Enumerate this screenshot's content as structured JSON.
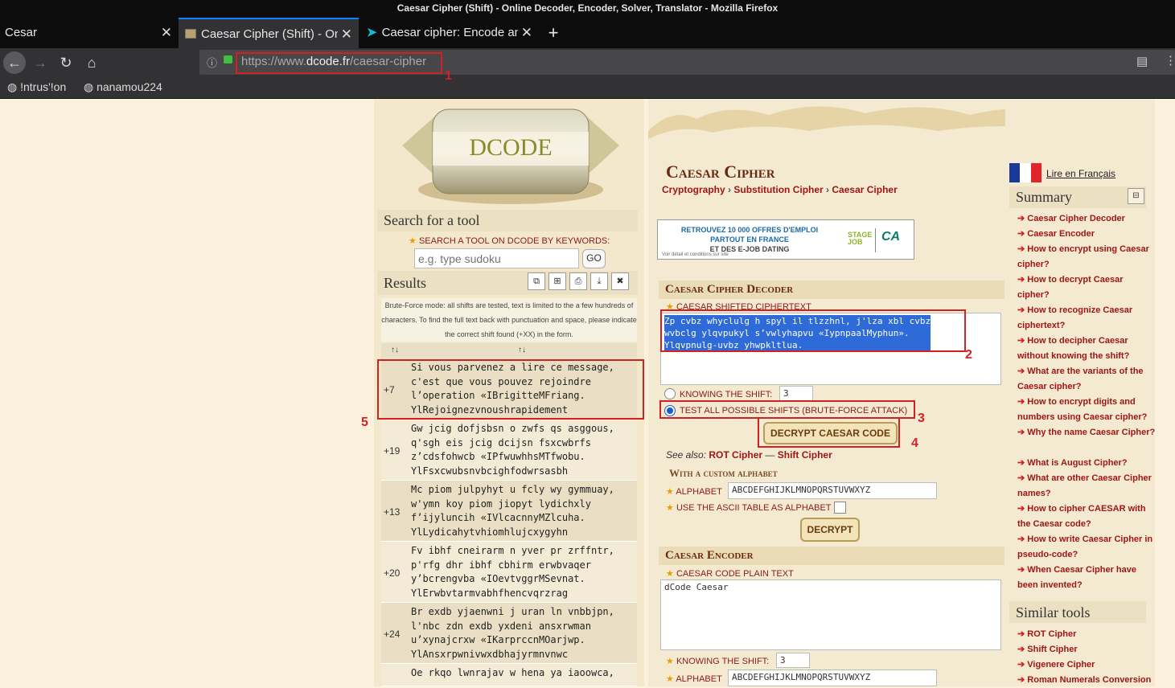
{
  "window": {
    "title": "Caesar Cipher (Shift) - Online Decoder, Encoder, Solver, Translator - Mozilla Firefox"
  },
  "tabs": [
    {
      "label": "Cesar"
    },
    {
      "label": "Caesar Cipher (Shift) - On"
    },
    {
      "label": "Caesar cipher: Encode an"
    }
  ],
  "url": {
    "prefix": "https://www.",
    "domain": "dcode.fr",
    "path": "/caesar-cipher"
  },
  "bookmarks": [
    {
      "label": "!ntrus'!on"
    },
    {
      "label": "nanamou224"
    }
  ],
  "annotations": [
    "1",
    "2",
    "3",
    "4",
    "5"
  ],
  "left": {
    "logo_text": "DCODE",
    "search_title": "Search for a tool",
    "search_label": "SEARCH A TOOL ON DCODE BY KEYWORDS:",
    "search_placeholder": "e.g. type sudoku",
    "go": "GO",
    "results_title": "Results",
    "brute_note": "Brute-Force mode: all shifts are tested, text is limited to the a few hundreds of characters. To find the full text back with punctuation and space, please indicate the correct shift found (+XX) in the form.",
    "sort1": "↑↓",
    "sort2": "↑↓",
    "rows": [
      {
        "shift": "+7",
        "text": "Si vous parvenez a lire ce message,\nc'est que vous pouvez rejoindre\nl’operation «IBrigitteMFriang.\nYlRejoignezvnoushrapidement"
      },
      {
        "shift": "+19",
        "text": "Gw jcig dofjsbsn o zwfs qs asggous,\nq'sgh eis jcig dcijsn fsxcwbrfs\nz’cdsfohwcb «IPfwuwhhsMTfwobu.\nYlFsxcwubsnvbcighfodwrsasbh"
      },
      {
        "shift": "+13",
        "text": "Mc piom julpyhyt u fcly wy gymmuay,\nw'ymn koy piom jiopyt lydichxly\nf’ijyluncih «IVlcacnnyMZlcuha.\nYlLydicahytvhiomhlujcxygyhn"
      },
      {
        "shift": "+20",
        "text": "Fv ibhf cneirarm n yver pr zrffntr,\np'rfg dhr ibhf cbhirm erwbvaqer\ny’bcrengvba «IOevtvggrMSevnat.\nYlErwbvtarmvabhfhencvqrzrag"
      },
      {
        "shift": "+24",
        "text": "Br exdb yjaenwni j uran ln vnbbjpn,\nl'nbc zdn exdb yxdeni ansxrwman\nu’xynajcrxw «IKarprccnMOarjwp.\nYlAnsxrpwnivwxdbhajyrmnvnwc"
      },
      {
        "shift": "",
        "text": "Oe rkqo lwnrajav w hena ya iaoowca,"
      }
    ]
  },
  "main": {
    "title": "Caesar Cipher",
    "breadcrumb": [
      "Cryptography",
      "Substitution Cipher",
      "Caesar Cipher"
    ],
    "ad": {
      "line1": "RETROUVEZ 10 000 OFFRES D'EMPLOI",
      "line2": "PARTOUT EN FRANCE",
      "line3": "ET DES E-JOB DATING",
      "small": "Voir détail et conditions sur site",
      "brand": "STAGE JOB",
      "brand2": "CA"
    },
    "decoder": {
      "title": "Caesar Cipher Decoder",
      "cipher_label": "CAESAR SHIFTED CIPHERTEXT",
      "ciphertext": "Zp cvbz whyclulg h spyl il tlzzhnl, j'lza xbl cvbz\nwvbclg ylqvpukyl s’vwlyhapvu «IypnpaalMyphun».\nYlqvpnulg-uvbz yhwpkltlua.",
      "knowing_label": "KNOWING THE SHIFT:",
      "shift_value": "3",
      "bruteforce_label": "TEST ALL POSSIBLE SHIFTS (BRUTE-FORCE ATTACK)",
      "decrypt_button": "DECRYPT CAESAR CODE",
      "see_also": "See also:",
      "see_also_1": "ROT Cipher",
      "see_also_sep": "—",
      "see_also_2": "Shift Cipher",
      "custom_alpha_title": "With a custom alphabet",
      "alphabet_label": "ALPHABET",
      "alphabet_value": "ABCDEFGHIJKLMNOPQRSTUVWXYZ",
      "ascii_label": "USE THE ASCII TABLE AS ALPHABET",
      "decrypt2": "DECRYPT"
    },
    "encoder": {
      "title": "Caesar Encoder",
      "plain_label": "CAESAR CODE PLAIN TEXT",
      "plain_value": "dCode Caesar",
      "knowing_label": "KNOWING THE SHIFT:",
      "shift_value": "3",
      "alphabet_label": "ALPHABET",
      "alphabet_value": "ABCDEFGHIJKLMNOPQRSTUVWXYZ"
    }
  },
  "right": {
    "lang_link": "Lire en Français",
    "summary_title": "Summary",
    "summary": [
      "Caesar Cipher Decoder",
      "Caesar Encoder",
      "How to encrypt using Caesar cipher?",
      "How to decrypt Caesar cipher?",
      "How to recognize Caesar ciphertext?",
      "How to decipher Caesar without knowing the shift?",
      "What are the variants of the Caesar cipher?",
      "How to encrypt digits and numbers using Caesar cipher?",
      "Why the name Caesar Cipher?",
      "What is August Cipher?",
      "What are other Caesar Cipher names?",
      "How to cipher CAESAR with the Caesar code?",
      "How to write Caesar Cipher in pseudo-code?",
      "When Caesar Cipher have been invented?"
    ],
    "similar_title": "Similar tools",
    "similar": [
      "ROT Cipher",
      "Shift Cipher",
      "Vigenere Cipher",
      "Roman Numerals Conversion"
    ]
  }
}
